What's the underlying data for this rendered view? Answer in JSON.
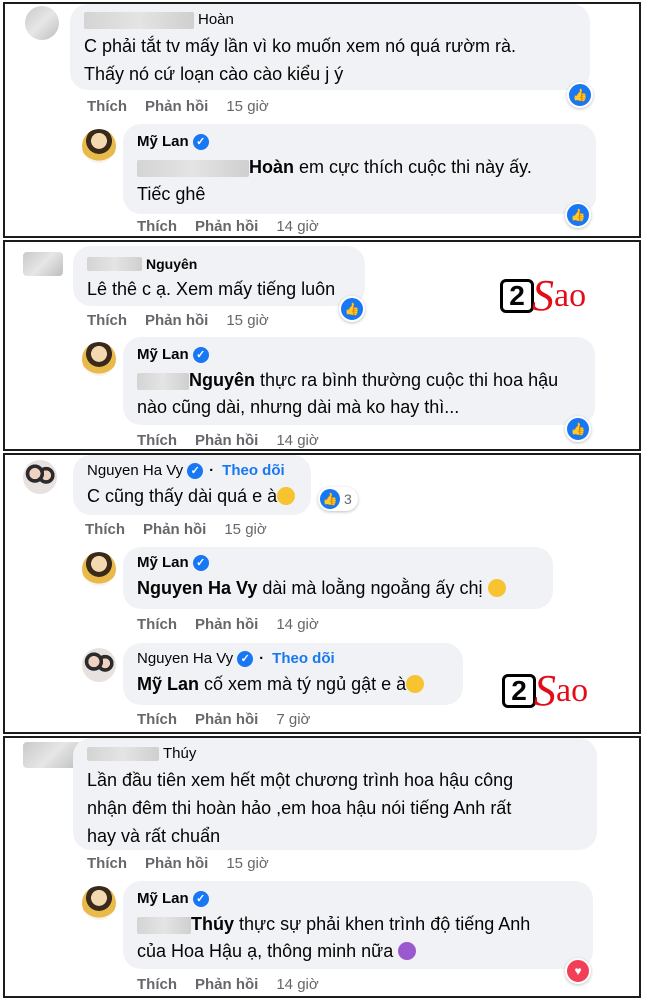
{
  "panels": [
    {
      "comment": {
        "name": "Hoàn",
        "text_lines": [
          "C phải tắt tv mấy lần vì ko muốn xem nó quá rườm rà.",
          "Thấy nó cứ loạn cào cào kiểu j ý"
        ],
        "like_label": "Thích",
        "reply_label": "Phản hồi",
        "time": "15 giờ"
      },
      "reply": {
        "name": "Mỹ Lan",
        "mention": "Hoàn",
        "text_after_mention": " em cực thích cuộc thi này ấy.",
        "text_line2": "Tiếc ghê",
        "like_label": "Thích",
        "reply_label": "Phản hồi",
        "time": "14 giờ"
      }
    },
    {
      "comment": {
        "name": "Nguyên",
        "text_lines": [
          "Lê thê c ạ. Xem mấy tiếng luôn"
        ],
        "like_label": "Thích",
        "reply_label": "Phản hồi",
        "time": "15 giờ"
      },
      "reply": {
        "name": "Mỹ Lan",
        "mention": "Nguyên",
        "text_after_mention": " thực ra bình thường cuộc thi hoa hậu",
        "text_line2": "nào cũng dài, nhưng dài mà ko hay thì...",
        "like_label": "Thích",
        "reply_label": "Phản hồi",
        "time": "14 giờ"
      }
    },
    {
      "comment": {
        "name": "Nguyen Ha Vy",
        "follow": "Theo dõi",
        "text": "C cũng thấy dài quá e à",
        "reaction_count": "3",
        "like_label": "Thích",
        "reply_label": "Phản hồi",
        "time": "15 giờ"
      },
      "reply1": {
        "name": "Mỹ Lan",
        "mention": "Nguyen Ha Vy",
        "text_after_mention": " dài mà loằng ngoằng ấy chị",
        "like_label": "Thích",
        "reply_label": "Phản hồi",
        "time": "14 giờ"
      },
      "reply2": {
        "name": "Nguyen Ha Vy",
        "follow": "Theo dõi",
        "mention": "Mỹ Lan",
        "text_after_mention": " cố xem mà tý ngủ gật e à",
        "like_label": "Thích",
        "reply_label": "Phản hồi",
        "time": "7 giờ"
      }
    },
    {
      "comment": {
        "name": "Thúy",
        "text_lines": [
          "Lần đầu tiên xem hết một chương trình hoa hậu công",
          "nhận đêm thi hoàn hảo ,em hoa hậu nói tiếng Anh rất",
          "hay và rất chuẩn"
        ],
        "like_label": "Thích",
        "reply_label": "Phản hồi",
        "time": "15 giờ"
      },
      "reply": {
        "name": "Mỹ Lan",
        "mention": "Thúy",
        "text_after_mention": " thực sự phải khen trình độ tiếng Anh",
        "text_line2": "của Hoa Hậu ạ, thông minh nữa",
        "like_label": "Thích",
        "reply_label": "Phản hồi",
        "time": "14 giờ"
      }
    }
  ],
  "watermark": {
    "digit": "2",
    "letter": "S",
    "rest": "ao"
  },
  "icons": {
    "like": "like-thumb-icon",
    "heart": "heart-icon",
    "verified": "verified-badge-icon"
  },
  "colors": {
    "accent": "#1877f2",
    "bubble": "#f0f2f5",
    "muted": "#65676b",
    "logo_red": "#e30d18"
  }
}
